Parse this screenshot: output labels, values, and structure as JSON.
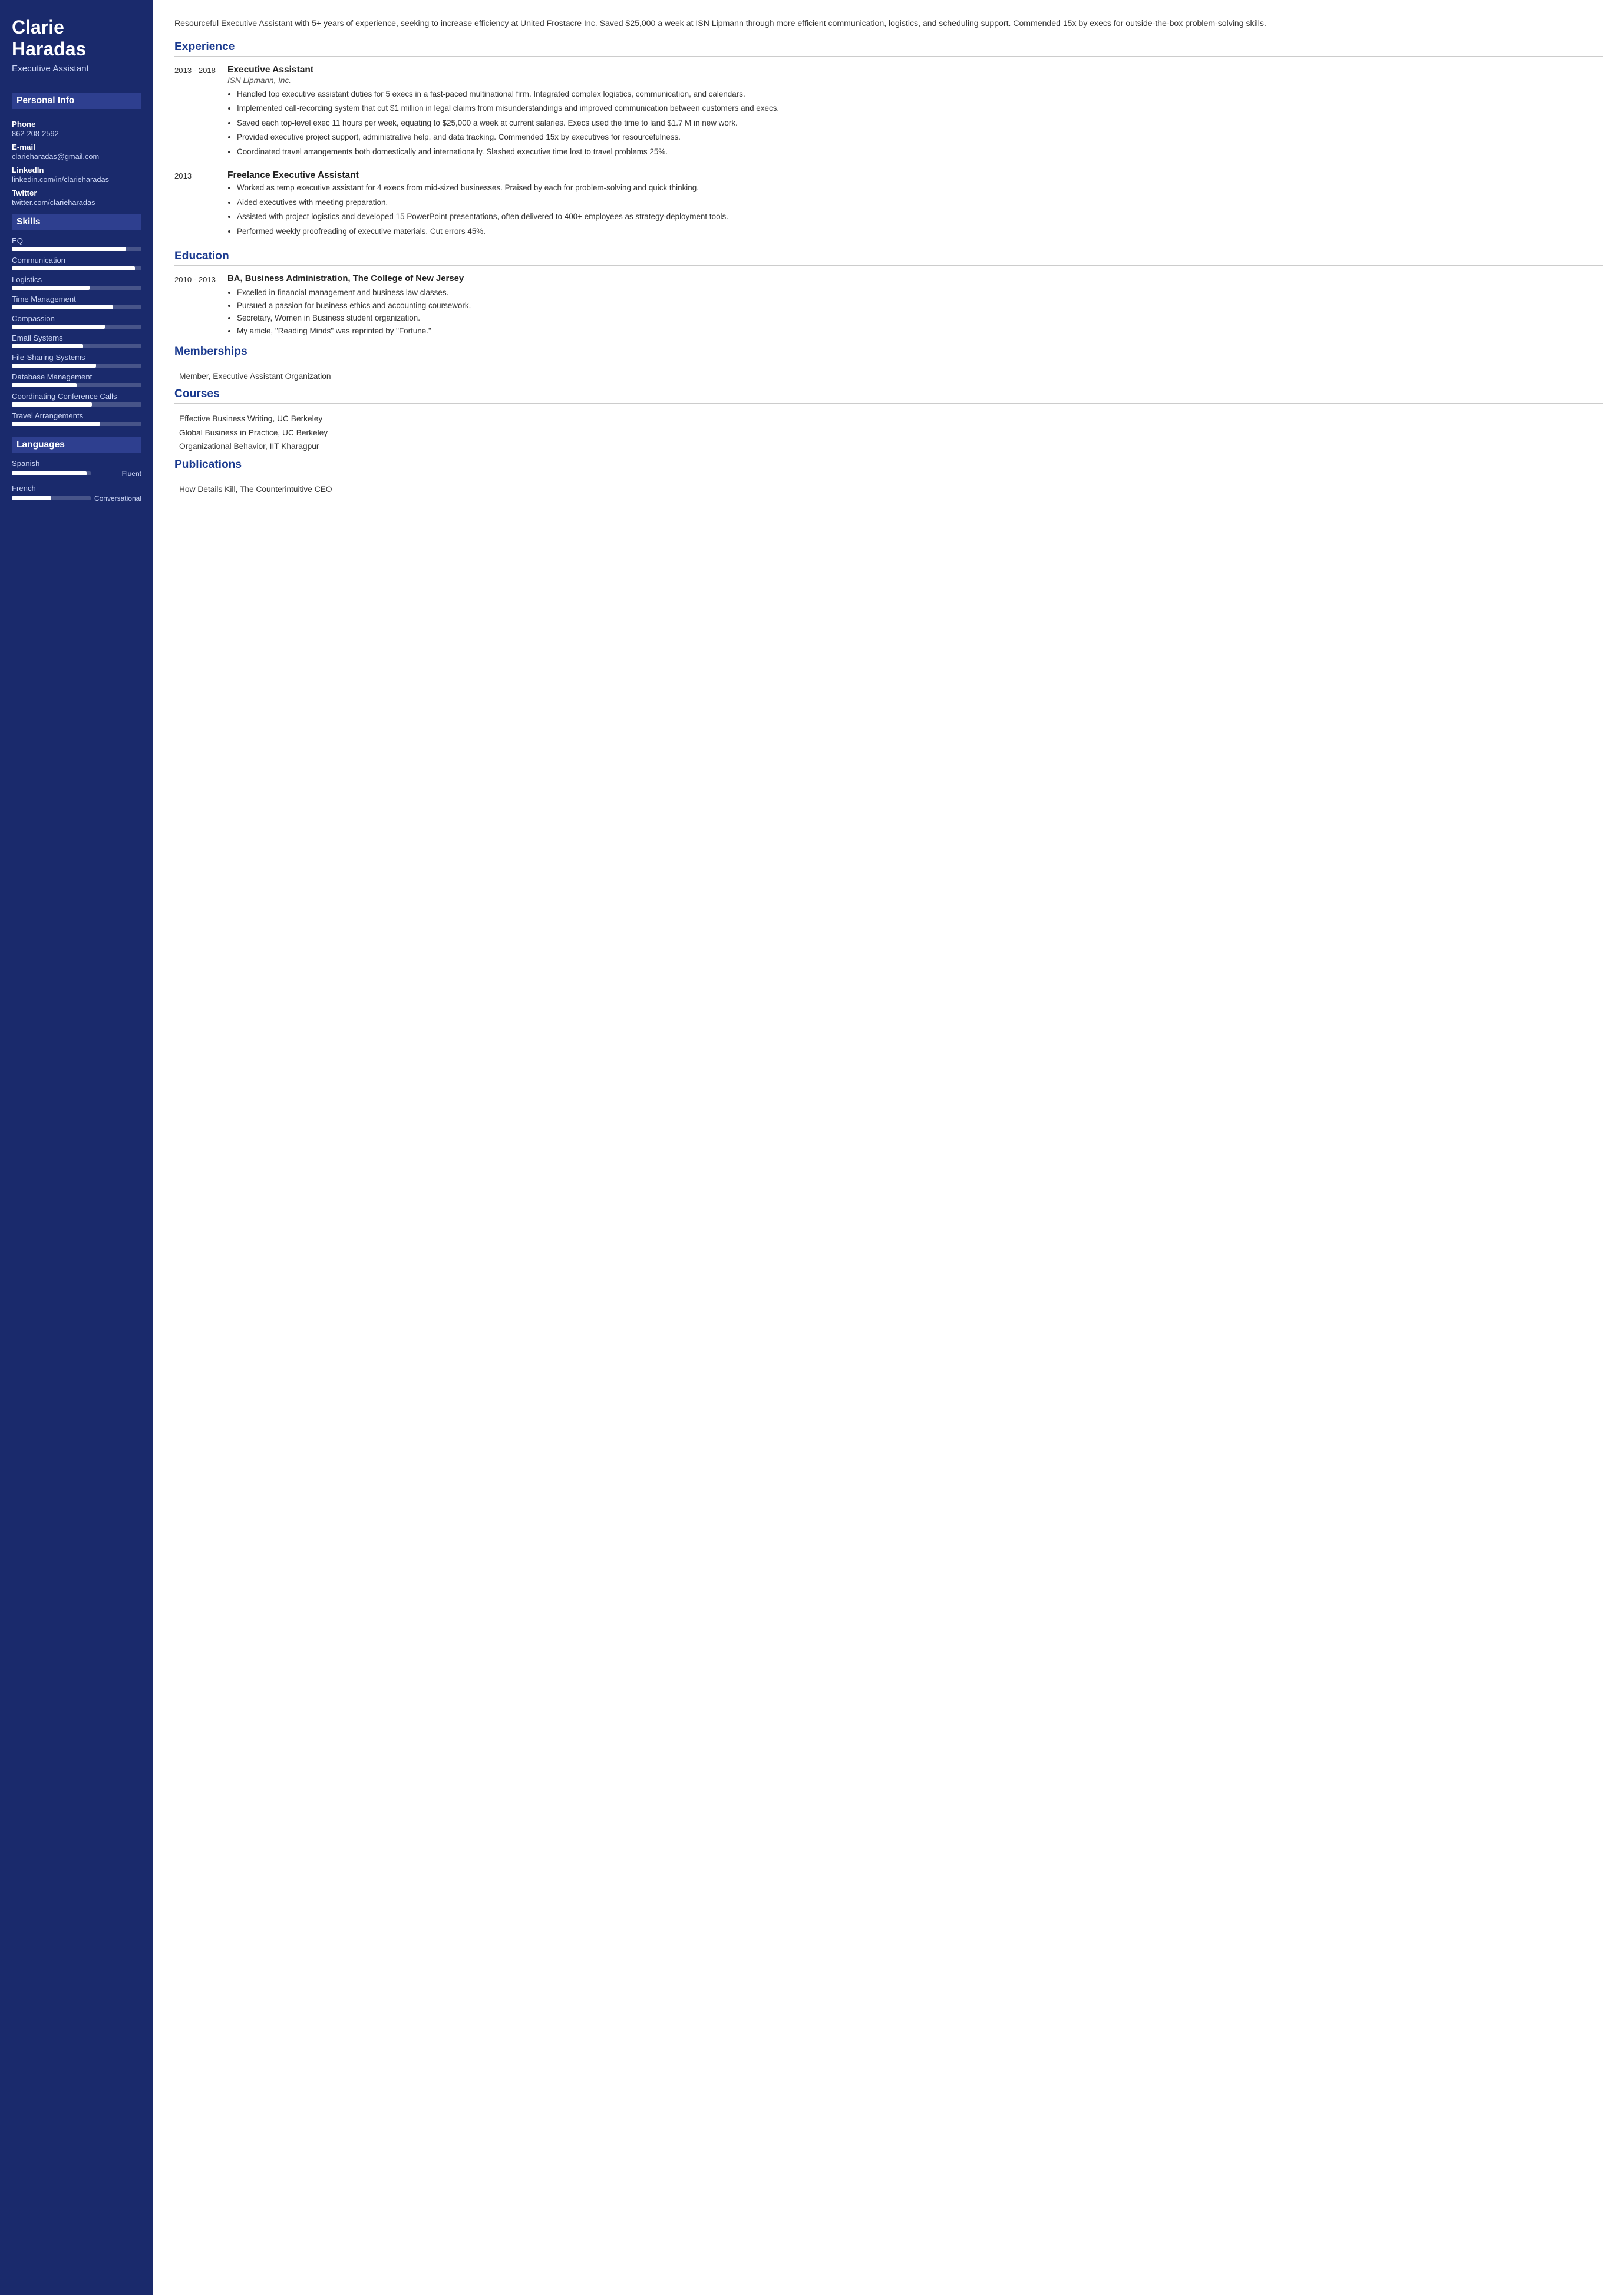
{
  "sidebar": {
    "name": "Clarie\nHaradas",
    "title": "Executive Assistant",
    "sections": {
      "personal_info": {
        "label": "Personal Info",
        "fields": [
          {
            "label": "Phone",
            "value": "862-208-2592"
          },
          {
            "label": "E-mail",
            "value": "clarieharadas@gmail.com"
          },
          {
            "label": "LinkedIn",
            "value": "linkedin.com/in/clarieharadas"
          },
          {
            "label": "Twitter",
            "value": "twitter.com/clarieharadas"
          }
        ]
      },
      "skills": {
        "label": "Skills",
        "items": [
          {
            "name": "EQ",
            "percent": 88
          },
          {
            "name": "Communication",
            "percent": 95
          },
          {
            "name": "Logistics",
            "percent": 60
          },
          {
            "name": "Time Management",
            "percent": 78
          },
          {
            "name": "Compassion",
            "percent": 72
          },
          {
            "name": "Email Systems",
            "percent": 55
          },
          {
            "name": "File-Sharing Systems",
            "percent": 65
          },
          {
            "name": "Database Management",
            "percent": 50
          },
          {
            "name": "Coordinating Conference Calls",
            "percent": 62
          },
          {
            "name": "Travel Arrangements",
            "percent": 68
          }
        ]
      },
      "languages": {
        "label": "Languages",
        "items": [
          {
            "name": "Spanish",
            "percent": 95,
            "level": "Fluent"
          },
          {
            "name": "French",
            "percent": 50,
            "level": "Conversational"
          }
        ]
      }
    }
  },
  "main": {
    "summary": "Resourceful Executive Assistant with 5+ years of experience, seeking to increase efficiency at United Frostacre Inc. Saved $25,000 a week at ISN Lipmann through more efficient communication, logistics, and scheduling support. Commended 15x by execs for outside-the-box problem-solving skills.",
    "experience_title": "Experience",
    "experience": [
      {
        "dates": "2013 - 2018",
        "title": "Executive Assistant",
        "company": "ISN Lipmann, Inc.",
        "bullets": [
          "Handled top executive assistant duties for 5 execs in a fast-paced multinational firm. Integrated complex logistics, communication, and calendars.",
          "Implemented call-recording system that cut $1 million in legal claims from misunderstandings and improved communication between customers and execs.",
          "Saved each top-level exec 11 hours per week, equating to $25,000 a week at current salaries. Execs used the time to land $1.7 M in new work.",
          "Provided executive project support, administrative help, and data tracking. Commended 15x by executives for resourcefulness.",
          "Coordinated travel arrangements both domestically and internationally. Slashed executive time lost to travel problems 25%."
        ]
      },
      {
        "dates": "2013",
        "title": "Freelance Executive Assistant",
        "company": "",
        "bullets": [
          "Worked as temp executive assistant for 4 execs from mid-sized businesses. Praised by each for problem-solving and quick thinking.",
          "Aided executives with meeting preparation.",
          "Assisted with project logistics and developed 15 PowerPoint presentations, often delivered to 400+ employees as strategy-deployment tools.",
          "Performed weekly proofreading of executive materials. Cut errors 45%."
        ]
      }
    ],
    "education_title": "Education",
    "education": [
      {
        "dates": "2010 - 2013",
        "degree": "BA, Business Administration, The College of New Jersey",
        "bullets": [
          "Excelled in financial management and business law classes.",
          "Pursued a passion for business ethics and accounting coursework.",
          "Secretary, Women in Business student organization.",
          "My article, \"Reading Minds\" was reprinted by \"Fortune.\""
        ]
      }
    ],
    "memberships_title": "Memberships",
    "memberships": [
      "Member, Executive Assistant Organization"
    ],
    "courses_title": "Courses",
    "courses": [
      "Effective Business Writing, UC Berkeley",
      "Global Business in Practice, UC Berkeley",
      "Organizational Behavior, IIT Kharagpur"
    ],
    "publications_title": "Publications",
    "publications": [
      "How Details Kill, The Counterintuitive CEO"
    ]
  }
}
